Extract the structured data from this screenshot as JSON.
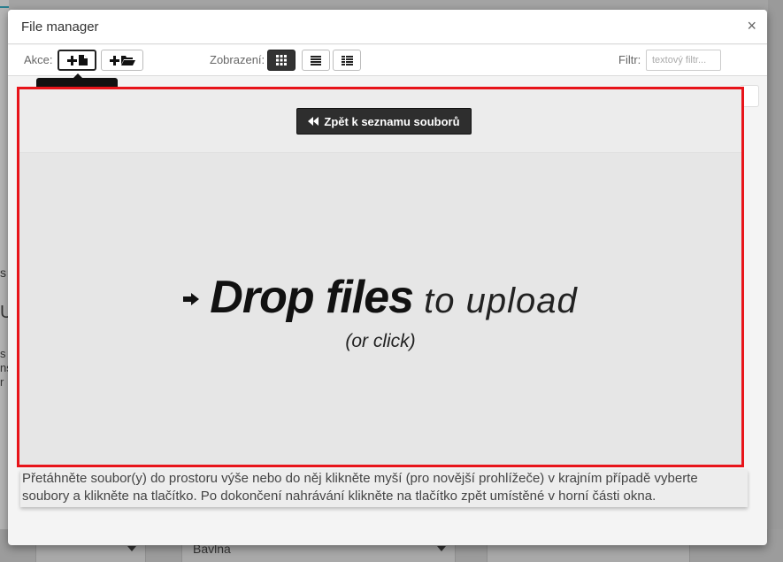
{
  "modal": {
    "title": "File manager",
    "close_icon": "×"
  },
  "toolbar": {
    "actions_label": "Akce:",
    "view_label": "Zobrazení:",
    "filter_label": "Filtr:",
    "filter_placeholder": "textový filtr..."
  },
  "dropzone": {
    "back_button_label": "Zpět k seznamu souborů",
    "drop_bold": "Drop files",
    "drop_light": "to upload",
    "drop_sub": "(or click)"
  },
  "help_text": "Přetáhněte soubor(y) do prostoru výše nebo do něj klikněte myší (pro novější prohlížeče) v krajním případě vyberte soubory a klikněte na tlačítko. Po dokončení nahrávání klikněte na tlačítko zpět umístěné v horní části okna.",
  "background": {
    "fragments": [
      "s",
      "U",
      "s",
      "ns",
      "r"
    ],
    "select_value": "Bavlna"
  },
  "colors": {
    "highlight": "#e8141a",
    "button_dark": "#2e2e2e"
  }
}
